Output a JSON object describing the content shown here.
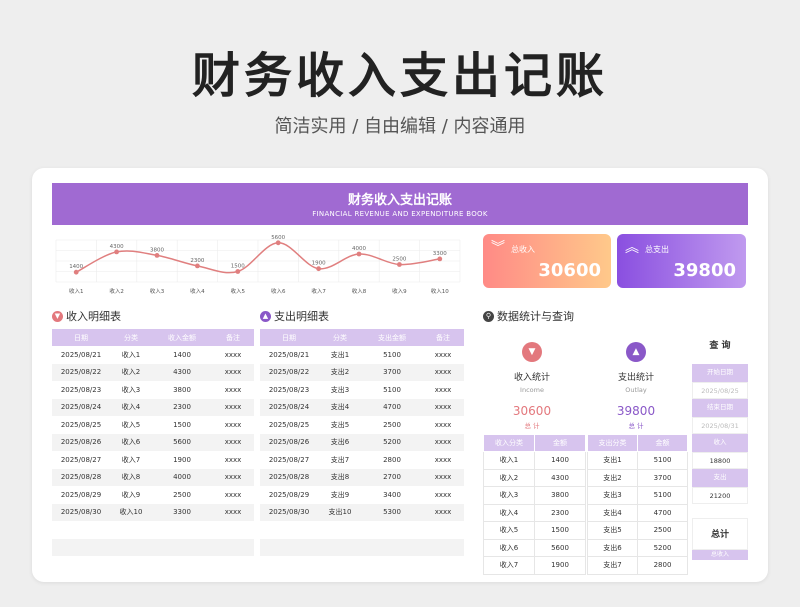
{
  "hero": {
    "title": "财务收入支出记账",
    "subtitle": "简洁实用 / 自由编辑 / 内容通用"
  },
  "banner": {
    "title": "财务收入支出记账",
    "subtitle": "FINANCIAL REVENUE AND EXPENDITURE BOOK"
  },
  "kpis": {
    "income_label": "总收入",
    "income_value": "30600",
    "expense_label": "总支出",
    "expense_value": "39800"
  },
  "colors": {
    "purple": "#a06ad2",
    "header_purple": "#d7c4ee",
    "income_red": "#e3787d",
    "expense_purple": "#8a58c8",
    "line": "#e07f7f"
  },
  "chart_data": {
    "type": "line",
    "categories": [
      "收入1",
      "收入2",
      "收入3",
      "收入4",
      "收入5",
      "收入6",
      "收入7",
      "收入8",
      "收入9",
      "收入10"
    ],
    "values": [
      1400,
      4300,
      3800,
      2300,
      1500,
      5600,
      1900,
      4000,
      2500,
      3300
    ],
    "ylim": [
      0,
      6000
    ],
    "grid": true,
    "data_labels": true
  },
  "income_section": {
    "title": "收入明细表"
  },
  "expense_section": {
    "title": "支出明细表"
  },
  "stats_section": {
    "title": "数据统计与查询"
  },
  "income_table": {
    "columns": [
      "日期",
      "分类",
      "收入金额",
      "备注"
    ],
    "rows": [
      [
        "2025/08/21",
        "收入1",
        "1400",
        "xxxx"
      ],
      [
        "2025/08/22",
        "收入2",
        "4300",
        "xxxx"
      ],
      [
        "2025/08/23",
        "收入3",
        "3800",
        "xxxx"
      ],
      [
        "2025/08/24",
        "收入4",
        "2300",
        "xxxx"
      ],
      [
        "2025/08/25",
        "收入5",
        "1500",
        "xxxx"
      ],
      [
        "2025/08/26",
        "收入6",
        "5600",
        "xxxx"
      ],
      [
        "2025/08/27",
        "收入7",
        "1900",
        "xxxx"
      ],
      [
        "2025/08/28",
        "收入8",
        "4000",
        "xxxx"
      ],
      [
        "2025/08/29",
        "收入9",
        "2500",
        "xxxx"
      ],
      [
        "2025/08/30",
        "收入10",
        "3300",
        "xxxx"
      ]
    ]
  },
  "expense_table": {
    "columns": [
      "日期",
      "分类",
      "支出金额",
      "备注"
    ],
    "rows": [
      [
        "2025/08/21",
        "支出1",
        "5100",
        "xxxx"
      ],
      [
        "2025/08/22",
        "支出2",
        "3700",
        "xxxx"
      ],
      [
        "2025/08/23",
        "支出3",
        "5100",
        "xxxx"
      ],
      [
        "2025/08/24",
        "支出4",
        "4700",
        "xxxx"
      ],
      [
        "2025/08/25",
        "支出5",
        "2500",
        "xxxx"
      ],
      [
        "2025/08/26",
        "支出6",
        "5200",
        "xxxx"
      ],
      [
        "2025/08/27",
        "支出7",
        "2800",
        "xxxx"
      ],
      [
        "2025/08/28",
        "支出8",
        "2700",
        "xxxx"
      ],
      [
        "2025/08/29",
        "支出9",
        "3400",
        "xxxx"
      ],
      [
        "2025/08/30",
        "支出10",
        "5300",
        "xxxx"
      ]
    ]
  },
  "income_stats": {
    "title": "收入统计",
    "subtitle": "Income",
    "total": "30600",
    "total_label": "总 计",
    "columns": [
      "收入分类",
      "金额"
    ],
    "rows": [
      [
        "收入1",
        "1400"
      ],
      [
        "收入2",
        "4300"
      ],
      [
        "收入3",
        "3800"
      ],
      [
        "收入4",
        "2300"
      ],
      [
        "收入5",
        "1500"
      ],
      [
        "收入6",
        "5600"
      ],
      [
        "收入7",
        "1900"
      ]
    ]
  },
  "expense_stats": {
    "title": "支出统计",
    "subtitle": "Outlay",
    "total": "39800",
    "total_label": "总 计",
    "columns": [
      "支出分类",
      "金额"
    ],
    "rows": [
      [
        "支出1",
        "5100"
      ],
      [
        "支出2",
        "3700"
      ],
      [
        "支出3",
        "5100"
      ],
      [
        "支出4",
        "4700"
      ],
      [
        "支出5",
        "2500"
      ],
      [
        "支出6",
        "5200"
      ],
      [
        "支出7",
        "2800"
      ]
    ]
  },
  "query": {
    "title": "查 询",
    "start_label": "开始日期",
    "start_value": "2025/08/25",
    "end_label": "结束日期",
    "end_value": "2025/08/31",
    "income_label": "收入",
    "income_value": "18800",
    "expense_label": "支出",
    "expense_value": "21200",
    "total_title": "总计",
    "total_label": "总收入"
  }
}
